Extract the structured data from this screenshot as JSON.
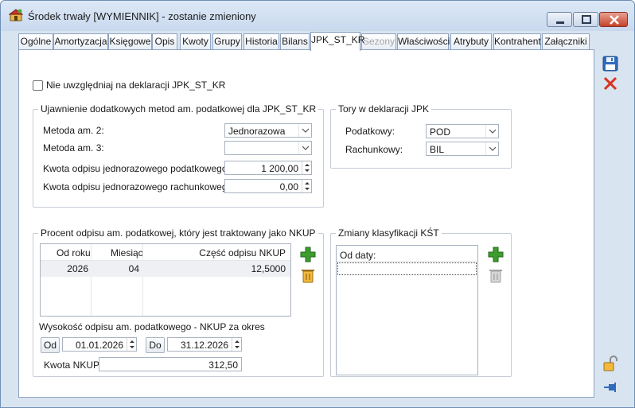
{
  "window": {
    "title": "Środek trwały [WYMIENNIK] - zostanie zmieniony"
  },
  "tabs": [
    {
      "label": "Ogólne",
      "state": "normal"
    },
    {
      "label": "Amortyzacja",
      "state": "normal"
    },
    {
      "label": "Księgowe",
      "state": "normal"
    },
    {
      "label": "Opis",
      "state": "normal"
    },
    {
      "label": "Kwoty",
      "state": "normal"
    },
    {
      "label": "Grupy",
      "state": "normal"
    },
    {
      "label": "Historia",
      "state": "normal"
    },
    {
      "label": "Bilans",
      "state": "normal"
    },
    {
      "label": "JPK_ST_KR",
      "state": "active"
    },
    {
      "label": "Sezony",
      "state": "disabled"
    },
    {
      "label": "Właściwości",
      "state": "normal"
    },
    {
      "label": "Atrybuty",
      "state": "normal"
    },
    {
      "label": "Kontrahent",
      "state": "normal"
    },
    {
      "label": "Załączniki",
      "state": "normal"
    }
  ],
  "exclude_checkbox": {
    "label": "Nie uwzględniaj na deklaracji JPK_ST_KR",
    "checked": false
  },
  "methods_group": {
    "title": "Ujawnienie dodatkowych metod am. podatkowej dla JPK_ST_KR",
    "method2_label": "Metoda am. 2:",
    "method2_value": "Jednorazowa",
    "method3_label": "Metoda am. 3:",
    "method3_value": "",
    "tax_writeoff_label": "Kwota odpisu jednorazowego podatkowego:",
    "tax_writeoff_value": "1 200,00",
    "book_writeoff_label": "Kwota odpisu jednorazowego rachunkowego:",
    "book_writeoff_value": "0,00"
  },
  "tracks_group": {
    "title": "Tory w deklaracji JPK",
    "tax_label": "Podatkowy:",
    "tax_value": "POD",
    "book_label": "Rachunkowy:",
    "book_value": "BIL"
  },
  "nkup_group": {
    "title": "Procent odpisu am. podatkowej, który jest traktowany jako NKUP",
    "columns": [
      "Od roku",
      "Miesiąc",
      "Część odpisu NKUP"
    ],
    "rows": [
      {
        "year": "2026",
        "month": "04",
        "share": "12,5000"
      }
    ],
    "period_label": "Wysokość odpisu am. podatkowego - NKUP za okres",
    "from_button": "Od",
    "from_date": "01.01.2026",
    "to_button": "Do",
    "to_date": "31.12.2026",
    "amount_label": "Kwota NKUP:",
    "amount_value": "312,50"
  },
  "kst_group": {
    "title": "Zmiany klasyfikacji KŚT",
    "column": "Od daty:"
  },
  "colors": {
    "accent_blue": "#2e6bbd",
    "delete_red": "#d9331f",
    "add_green": "#3c9d2c"
  },
  "icons": {
    "save": "floppy-disk-icon",
    "cancel": "red-x-icon",
    "add": "green-plus-icon",
    "delete": "trash-icon",
    "lock": "open-padlock-icon",
    "pin": "pushpin-icon"
  }
}
